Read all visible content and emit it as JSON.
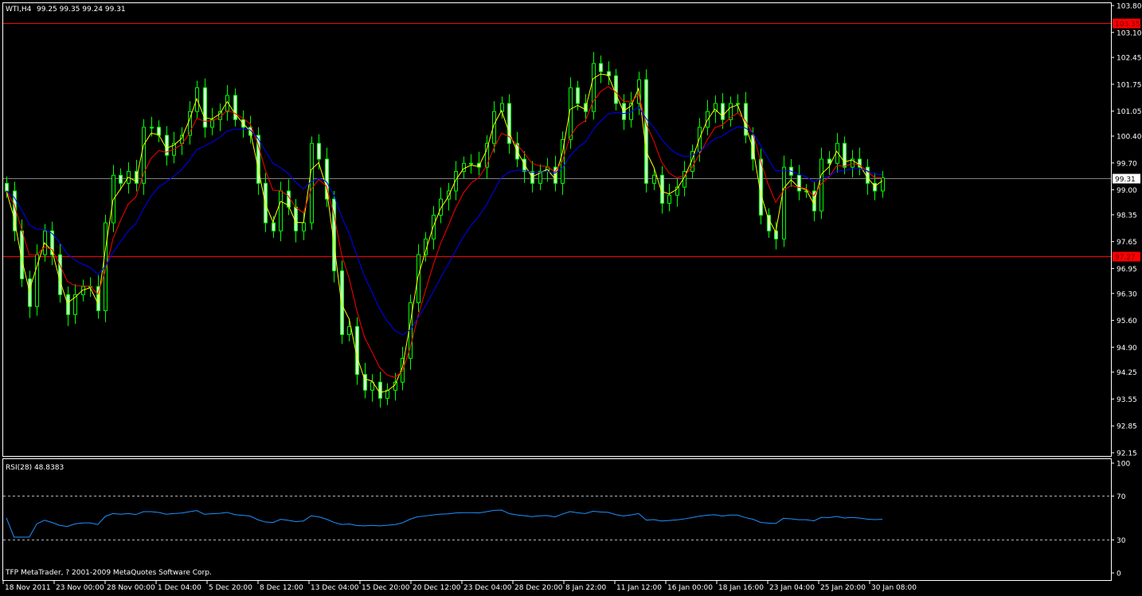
{
  "header": {
    "symbol_timeframe": "WTI,H4",
    "ohlc_readout": "99.25 99.35 99.24 99.31"
  },
  "rsi_panel": {
    "label": "RSI(28) 48.8383",
    "levels": [
      70,
      30
    ],
    "axis_ticks": [
      "100",
      "70",
      "30",
      "0"
    ]
  },
  "footer": {
    "copyright": "TFP MetaTrader, ? 2001-2009 MetaQuotes Software Corp."
  },
  "colors": {
    "background": "#000000",
    "candle": "#00ff00",
    "candle_body": "#c8ffc8",
    "ma_fast": "#ffff00",
    "ma_mid": "#ff0000",
    "ma_slow": "#0000ff",
    "rsi": "#1e90ff",
    "level_line": "#ff0000",
    "frame": "#ffffff"
  },
  "chart_data": {
    "type": "candlestick",
    "symbol": "WTI",
    "timeframe": "H4",
    "ylim": [
      92.15,
      103.8
    ],
    "y_ticks": [
      "103.80",
      "103.10",
      "102.45",
      "101.75",
      "101.05",
      "100.40",
      "99.70",
      "99.00",
      "98.35",
      "97.65",
      "96.95",
      "96.30",
      "95.60",
      "94.90",
      "94.25",
      "93.55",
      "92.85",
      "92.15"
    ],
    "x_ticks": [
      "18 Nov 2011",
      "23 Nov 00:00",
      "28 Nov 00:00",
      "1 Dec 04:00",
      "5 Dec 20:00",
      "8 Dec 12:00",
      "13 Dec 04:00",
      "15 Dec 20:00",
      "20 Dec 12:00",
      "23 Dec 04:00",
      "28 Dec 20:00",
      "8 Jan 22:00",
      "11 Jan 12:00",
      "16 Jan 00:00",
      "18 Jan 16:00",
      "23 Jan 04:00",
      "25 Jan 20:00",
      "30 Jan 08:00"
    ],
    "horizontal_lines": [
      {
        "price": "103.35",
        "color": "#ff0000"
      },
      {
        "price": "97.27",
        "color": "#ff0000"
      },
      {
        "price": "99.31",
        "color": "#808080",
        "label_bg": "#ffffff"
      }
    ],
    "closes": [
      98.97,
      97.93,
      96.68,
      95.96,
      97.31,
      97.93,
      97.31,
      96.27,
      95.75,
      96.27,
      96.48,
      96.48,
      95.85,
      98.14,
      99.38,
      99.17,
      99.48,
      99.17,
      100.63,
      100.63,
      100.42,
      99.9,
      100.21,
      100.42,
      101.04,
      101.66,
      100.63,
      100.83,
      101.04,
      101.46,
      100.83,
      100.63,
      100.42,
      99.17,
      98.14,
      97.93,
      98.97,
      98.55,
      97.93,
      98.14,
      100.21,
      99.8,
      98.76,
      96.89,
      95.23,
      95.44,
      94.19,
      93.78,
      93.99,
      93.57,
      93.78,
      93.99,
      94.61,
      96.06,
      97.31,
      97.72,
      98.34,
      98.76,
      98.97,
      99.48,
      99.69,
      99.69,
      99.59,
      100.21,
      101.04,
      101.25,
      100.21,
      99.8,
      99.48,
      99.17,
      99.48,
      99.59,
      99.17,
      100.31,
      101.66,
      101.25,
      101.04,
      102.29,
      102.08,
      101.97,
      101.25,
      100.83,
      101.25,
      101.87,
      99.17,
      99.38,
      98.65,
      98.86,
      99.07,
      99.48,
      100.0,
      100.63,
      101.04,
      101.25,
      100.83,
      101.25,
      101.25,
      100.42,
      99.8,
      98.34,
      97.93,
      97.72,
      99.59,
      99.38,
      98.97,
      98.97,
      98.45,
      99.8,
      99.69,
      100.21,
      99.59,
      99.8,
      99.59,
      99.17,
      98.97,
      99.31
    ],
    "last_rsi": 48.8383,
    "rsi_ylim": [
      0,
      100
    ]
  }
}
